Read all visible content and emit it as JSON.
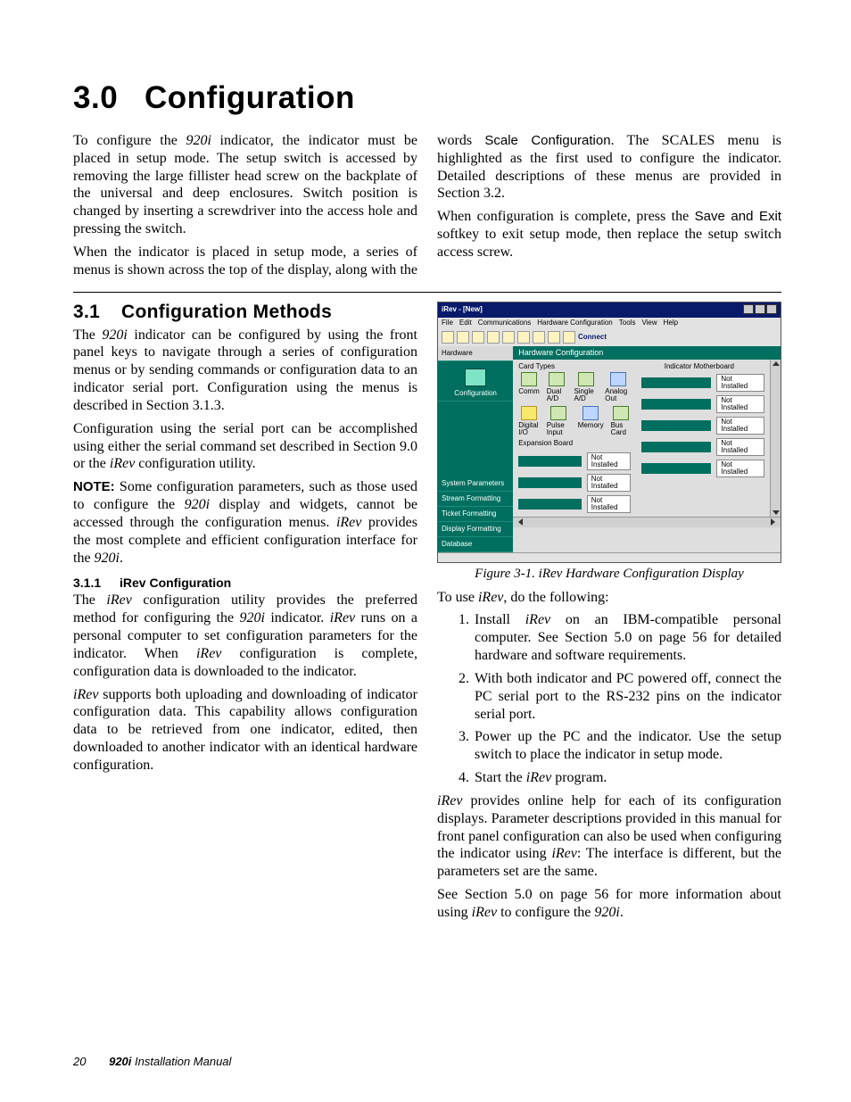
{
  "page": {
    "number": "20",
    "publication_model": "920i",
    "publication_title": "Installation Manual"
  },
  "title": {
    "num": "3.0",
    "text": "Configuration"
  },
  "intro": {
    "p1a": "To configure the ",
    "p1_em": "920i",
    "p1b": " indicator, the indicator must be placed in setup mode. The setup switch is accessed by removing the large fillister head screw on the backplate of the universal and deep enclosures. Switch position is changed by inserting a screwdriver into the access hole and pressing the switch.",
    "p2a": "When the indicator is placed in setup mode, a series of menus is shown across the top of the display, along with the words ",
    "p2_sans": "Scale Configuration",
    "p2b": ". The SCALES menu is highlighted as the first used to configure the indicator. Detailed descriptions of these menus are provided in Section 3.2.",
    "p3a": "When configuration is complete, press the ",
    "p3_sans": "Save and Exit",
    "p3b": " softkey to exit setup mode, then replace the setup switch access screw."
  },
  "s31": {
    "num": "3.1",
    "title": "Configuration Methods",
    "p1a": "The ",
    "p1_em": "920i",
    "p1b": " indicator can be configured by using the front panel keys to navigate through a series of configuration menus or by sending commands or configuration data to an indicator serial port. Configuration using the menus is described in Section 3.1.3.",
    "p2a": "Configuration using the serial port can be accomplished using either the serial command set described in Section 9.0 or the ",
    "p2_em": "iRev",
    "p2b": " configuration utility.",
    "note_label": "NOTE:",
    "note_a": " Some configuration parameters, such as those used to configure the ",
    "note_em1": "920i",
    "note_b": " display and widgets, cannot be accessed through the configuration menus. ",
    "note_em2": "iRev",
    "note_c": " provides the most complete and efficient configuration interface for the ",
    "note_em3": "920i",
    "note_d": "."
  },
  "s311": {
    "num": "3.1.1",
    "title": "iRev Configuration",
    "p1a": "The ",
    "p1_em1": "iRev",
    "p1b": " configuration utility provides the preferred method for configuring the ",
    "p1_em2": "920i",
    "p1c": " indicator. ",
    "p1_em3": "iRev",
    "p1d": " runs on a personal computer to set configuration parameters for the indicator. When ",
    "p1_em4": "iRev",
    "p1e": " configuration is complete, configuration data is downloaded to the indicator.",
    "p2_em": "iRev",
    "p2a": " supports both uploading and downloading of indicator configuration data. This capability allows configuration data to be retrieved from one indicator, edited, then downloaded to another indicator with an identical hardware configuration."
  },
  "figure": {
    "caption": "Figure 3-1. iRev Hardware Configuration Display",
    "window_title": "iRev - [New]",
    "menus": [
      "File",
      "Edit",
      "Communications",
      "Hardware Configuration",
      "Tools",
      "View",
      "Help"
    ],
    "connect": "Connect",
    "sidebar": [
      "Hardware",
      "Configuration",
      "System Parameters",
      "Stream Formatting",
      "Ticket Formatting",
      "Display Formatting",
      "Database"
    ],
    "panel_title": "Hardware Configuration",
    "cardtypes_label": "Card Types",
    "cards": [
      "Comm",
      "Dual A/D",
      "Single A/D",
      "Analog Out",
      "Digital I/O",
      "Pulse Input",
      "Memory",
      "Bus Card"
    ],
    "expboard": "Expansion Board",
    "mb_label": "Indicator Motherboard",
    "not_installed": "Not Installed"
  },
  "after_fig": {
    "lead_a": "To use ",
    "lead_em": "iRev",
    "lead_b": ", do the following:",
    "steps": {
      "s1a": "Install ",
      "s1_em": "iRev",
      "s1b": " on an IBM-compatible personal computer. See Section 5.0 on page 56 for detailed hardware and software requirements.",
      "s2": "With both indicator and PC powered off, connect the PC serial port to the RS-232 pins on the indicator serial port.",
      "s3": "Power up the PC and the indicator. Use the setup switch to place the indicator in setup mode.",
      "s4a": "Start the ",
      "s4_em": "iRev",
      "s4b": " program."
    },
    "p1_em1": "iRev",
    "p1a": " provides online help for each of its configuration displays. Parameter descriptions provided in this manual for front panel configuration can also be used when configuring the indicator using ",
    "p1_em2": "iRev",
    "p1b": ": The interface is different, but the parameters set are the same.",
    "p2a": "See Section 5.0 on page 56 for more information about using ",
    "p2_em1": "iRev",
    "p2b": " to configure the ",
    "p2_em2": "920i",
    "p2c": "."
  }
}
